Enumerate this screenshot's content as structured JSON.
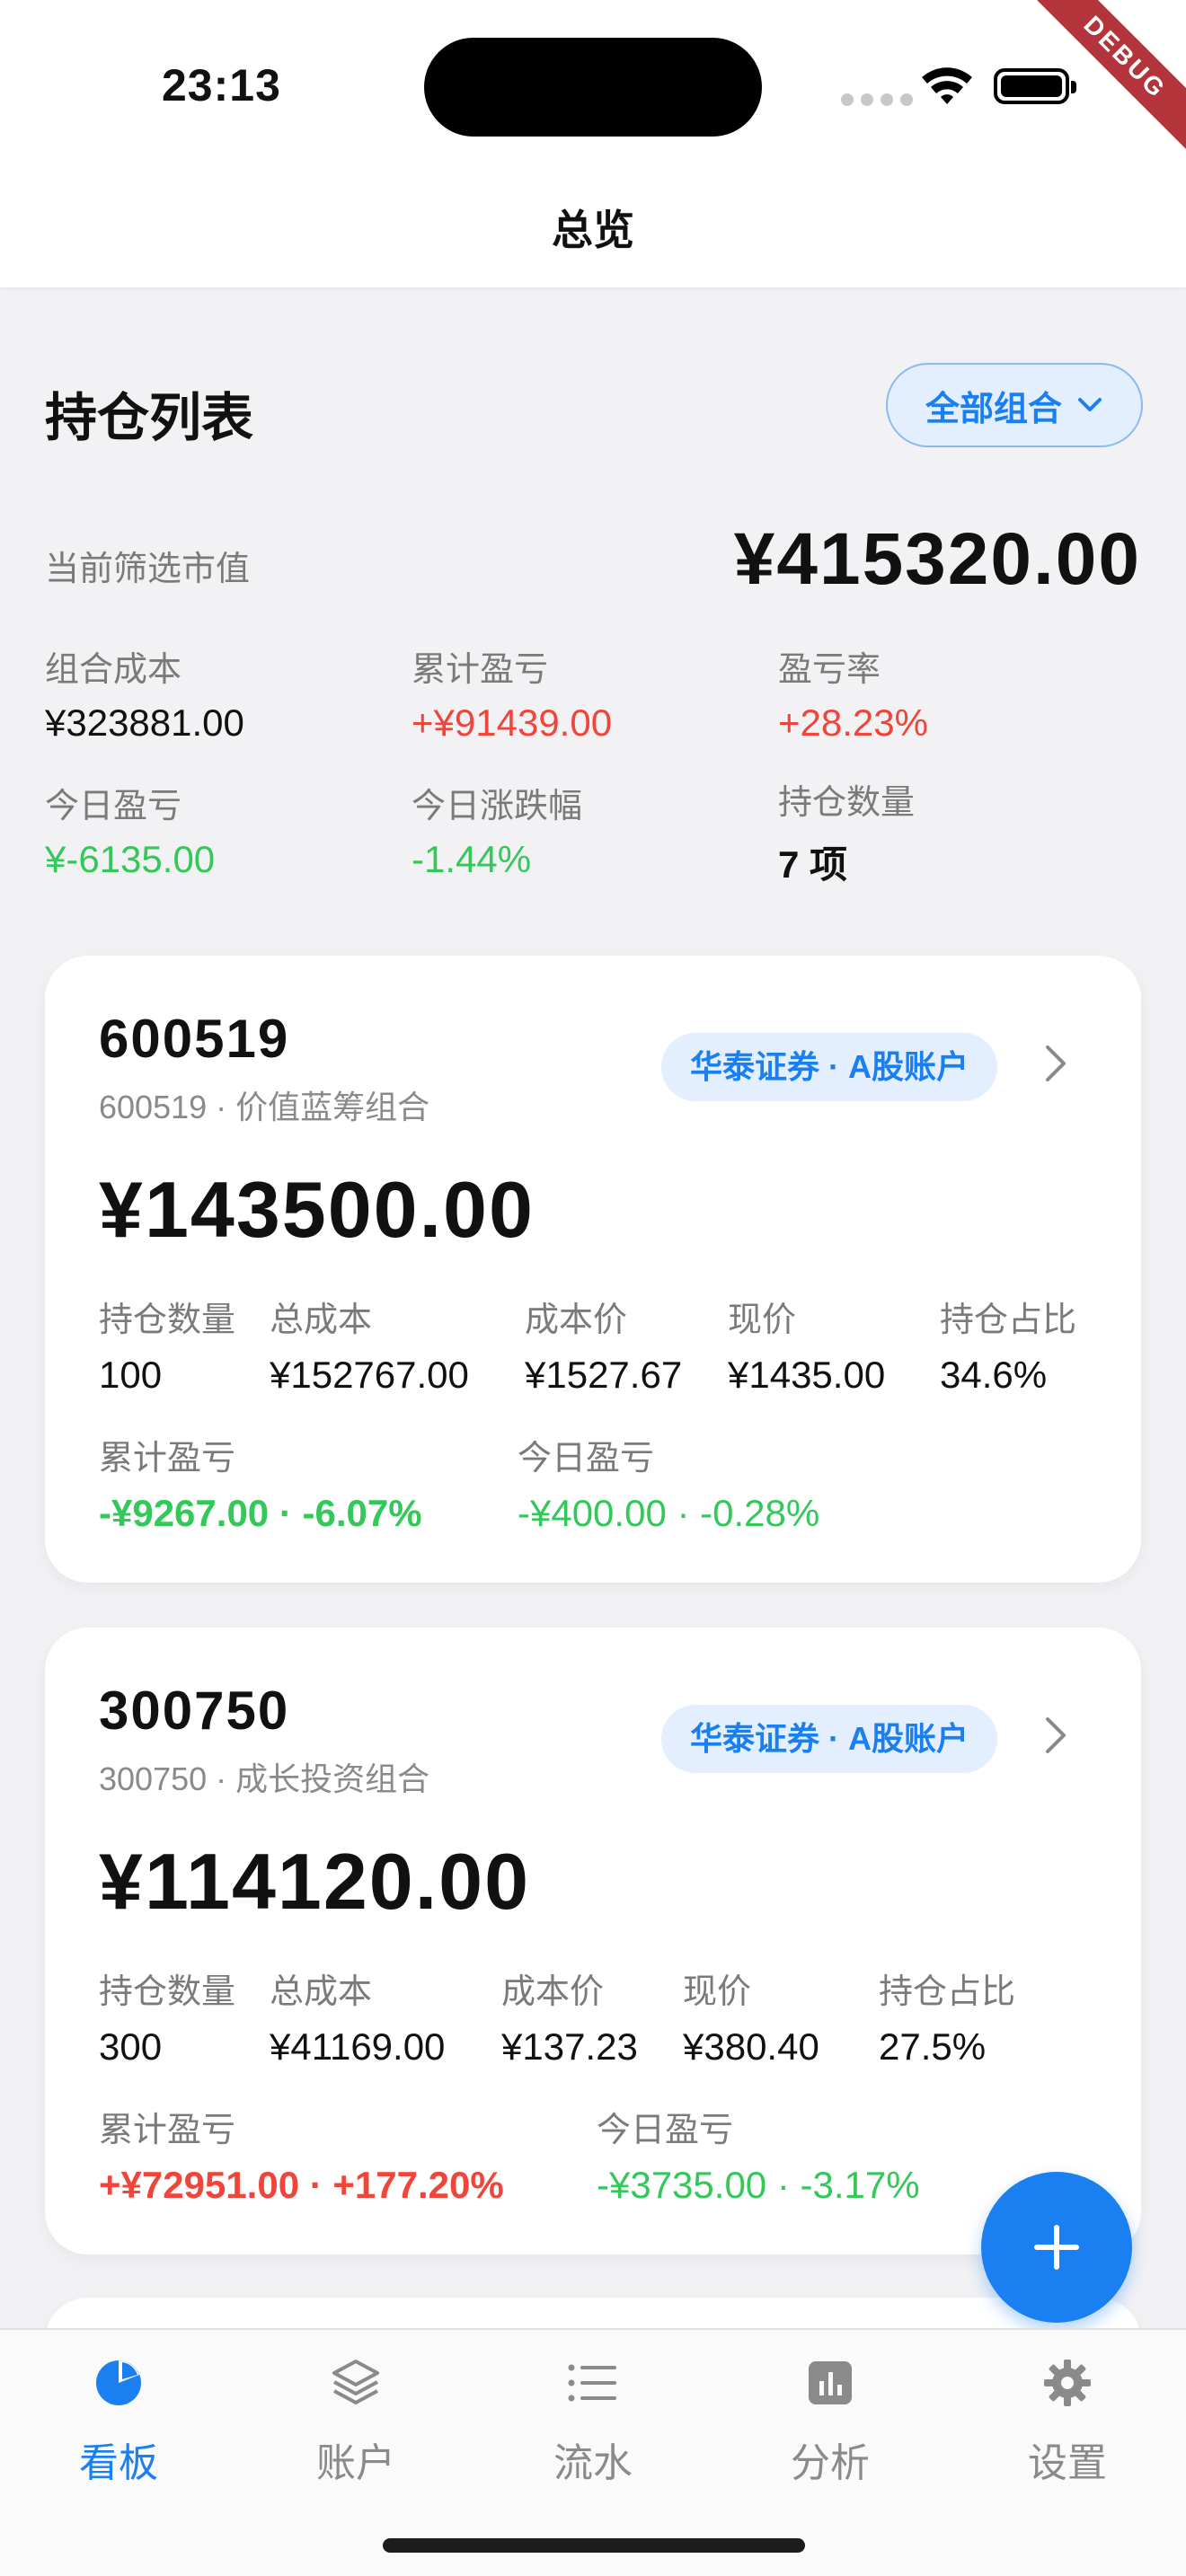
{
  "status": {
    "time": "23:13",
    "debug": "DEBUG"
  },
  "nav": {
    "title": "总览"
  },
  "summary": {
    "title": "持仓列表",
    "filter_label": "全部组合",
    "market_value_label": "当前筛选市值",
    "market_value": "¥415320.00",
    "metrics": [
      {
        "label": "组合成本",
        "value": "¥323881.00"
      },
      {
        "label": "累计盈亏",
        "value": "+¥91439.00"
      },
      {
        "label": "盈亏率",
        "value": "+28.23%"
      },
      {
        "label": "今日盈亏",
        "value": "¥-6135.00"
      },
      {
        "label": "今日涨跌幅",
        "value": "-1.44%"
      },
      {
        "label": "持仓数量",
        "value": "7 项"
      }
    ]
  },
  "holdings": [
    {
      "code": "600519",
      "subtitle": "600519 · 价值蓝筹组合",
      "account": "华泰证券 · A股账户",
      "value": "¥143500.00",
      "fields": [
        {
          "label": "持仓数量",
          "value": "100"
        },
        {
          "label": "总成本",
          "value": "¥152767.00"
        },
        {
          "label": "成本价",
          "value": "¥1527.67"
        },
        {
          "label": "现价",
          "value": "¥1435.00"
        },
        {
          "label": "持仓占比",
          "value": "34.6%"
        }
      ],
      "total_pnl_label": "累计盈亏",
      "total_pnl": "-¥9267.00 · -6.07%",
      "today_pnl_label": "今日盈亏",
      "today_pnl": "-¥400.00 · -0.28%"
    },
    {
      "code": "300750",
      "subtitle": "300750 · 成长投资组合",
      "account": "华泰证券 · A股账户",
      "value": "¥114120.00",
      "fields": [
        {
          "label": "持仓数量",
          "value": "300"
        },
        {
          "label": "总成本",
          "value": "¥41169.00"
        },
        {
          "label": "成本价",
          "value": "¥137.23"
        },
        {
          "label": "现价",
          "value": "¥380.40"
        },
        {
          "label": "持仓占比",
          "value": "27.5%"
        }
      ],
      "total_pnl_label": "累计盈亏",
      "total_pnl": "+¥72951.00 · +177.20%",
      "today_pnl_label": "今日盈亏",
      "today_pnl": "-¥3735.00 · -3.17%"
    }
  ],
  "tabs": [
    {
      "label": "看板",
      "icon": "pie-chart-icon",
      "active": true
    },
    {
      "label": "账户",
      "icon": "layers-icon",
      "active": false
    },
    {
      "label": "流水",
      "icon": "list-icon",
      "active": false
    },
    {
      "label": "分析",
      "icon": "bar-chart-icon",
      "active": false
    },
    {
      "label": "设置",
      "icon": "gear-icon",
      "active": false
    }
  ],
  "colors": {
    "accent": "#1a7ff0",
    "gain": "#f0453a",
    "loss": "#34c759"
  }
}
